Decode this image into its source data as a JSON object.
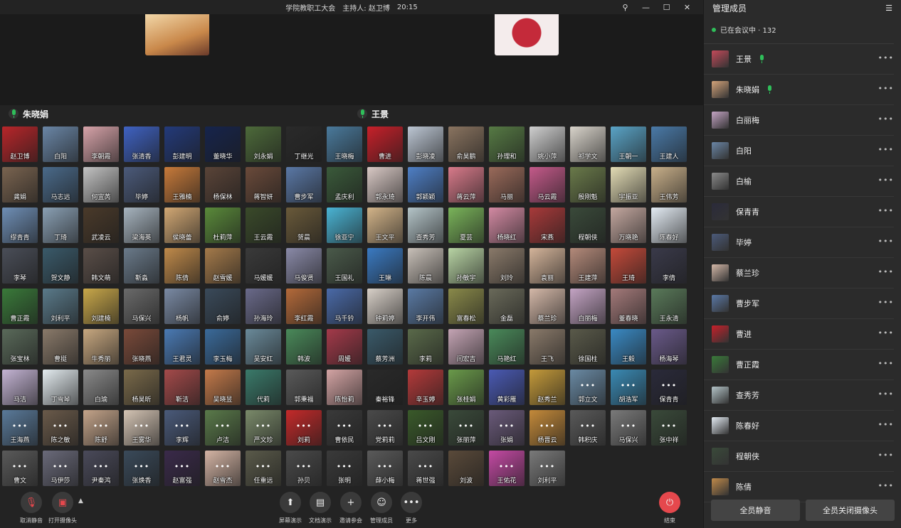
{
  "title": {
    "meeting": "学院教职工大会",
    "host": "主持人: 赵卫博",
    "time": "20:15"
  },
  "speakers": [
    {
      "name": "朱晓娟"
    },
    {
      "name": "王景"
    }
  ],
  "participants": [
    {
      "name": "赵卫博",
      "color": "#b8262a"
    },
    {
      "name": "白阳",
      "color": "#6a86a6"
    },
    {
      "name": "李朝霞",
      "color": "#d7a3a9"
    },
    {
      "name": "张清香",
      "color": "#3f62c2"
    },
    {
      "name": "彭建明",
      "color": "#233a7a"
    },
    {
      "name": "董晓华",
      "color": "#16244c"
    },
    {
      "name": "刘永娟",
      "color": "#4d6a3a"
    },
    {
      "name": "丁继光",
      "color": "#2a2a2a"
    },
    {
      "name": "王晓梅",
      "color": "#4a7a9c"
    },
    {
      "name": "曹进",
      "color": "#c7202a"
    },
    {
      "name": "彭晓凌",
      "color": "#bcc6d3"
    },
    {
      "name": "俞昊鹏",
      "color": "#8a7460"
    },
    {
      "name": "孙理和",
      "color": "#567a44"
    },
    {
      "name": "姚小萍",
      "color": "#cfcfcf"
    },
    {
      "name": "祁学文",
      "color": "#d9d4cb"
    },
    {
      "name": "王朝一",
      "color": "#5aa4c7"
    },
    {
      "name": "王建人",
      "color": "#4a7aa8"
    },
    {
      "name": "龚娟",
      "color": "#7a6450"
    },
    {
      "name": "马志远",
      "color": "#4a6a8a"
    },
    {
      "name": "何宜芮",
      "color": "#c3c3c3"
    },
    {
      "name": "毕婷",
      "color": "#4b5a7a"
    },
    {
      "name": "王雅楠",
      "color": "#c77a3a"
    },
    {
      "name": "杨保林",
      "color": "#5a4438"
    },
    {
      "name": "蒋智妍",
      "color": "#6a4a3a"
    },
    {
      "name": "曹步军",
      "color": "#5a78a6"
    },
    {
      "name": "孟庆利",
      "color": "#3a5a3a"
    },
    {
      "name": "郭永琦",
      "color": "#d9c9c5"
    },
    {
      "name": "郭颖颖",
      "color": "#4e7fc6"
    },
    {
      "name": "蒋云萍",
      "color": "#d87a8a"
    },
    {
      "name": "马丽",
      "color": "#9a6a5a"
    },
    {
      "name": "马云霞",
      "color": "#c45a8a"
    },
    {
      "name": "殷刚魁",
      "color": "#6a7a4a"
    },
    {
      "name": "宇振亚",
      "color": "#e3dcb5"
    },
    {
      "name": "王伟芳",
      "color": "#c9b08a"
    },
    {
      "name": "缪青青",
      "color": "#6f8fb6"
    },
    {
      "name": "丁琦",
      "color": "#8aa0b4"
    },
    {
      "name": "武凌云",
      "color": "#4a3a2a"
    },
    {
      "name": "梁海英",
      "color": "#a7b4bf"
    },
    {
      "name": "侯晓蕾",
      "color": "#d2a874"
    },
    {
      "name": "杜莉萍",
      "color": "#5a8a3a"
    },
    {
      "name": "王云霞",
      "color": "#3a4a2a"
    },
    {
      "name": "贺晨",
      "color": "#6a5a3a"
    },
    {
      "name": "徐亚宁",
      "color": "#4ab4d4"
    },
    {
      "name": "王文平",
      "color": "#d3b489"
    },
    {
      "name": "查秀芳",
      "color": "#b4c4c8"
    },
    {
      "name": "夏芸",
      "color": "#7ab45a"
    },
    {
      "name": "杨晓红",
      "color": "#d38aa3"
    },
    {
      "name": "宋燕",
      "color": "#a83a3a"
    },
    {
      "name": "程朝侠",
      "color": "#3a4a3a"
    },
    {
      "name": "万晓艳",
      "color": "#c4a8a0"
    },
    {
      "name": "陈春好",
      "color": "#e4ecf4"
    },
    {
      "name": "李琴",
      "color": "#4a4e58"
    },
    {
      "name": "贺文静",
      "color": "#3a5a6a"
    },
    {
      "name": "韩文萌",
      "color": "#5a4e48"
    },
    {
      "name": "靳淼",
      "color": "#6a7a8a"
    },
    {
      "name": "陈倩",
      "color": "#c08a4a"
    },
    {
      "name": "赵雪媛",
      "color": "#a47a4a"
    },
    {
      "name": "马媛媛",
      "color": "#3a3a3a"
    },
    {
      "name": "马俊贤",
      "color": "#8a8aa8"
    },
    {
      "name": "王国礼",
      "color": "#4a5a4a"
    },
    {
      "name": "王琳",
      "color": "#3a7ac2"
    },
    {
      "name": "陈晨",
      "color": "#c8c0b8"
    },
    {
      "name": "孙敏宇",
      "color": "#b8d4a4"
    },
    {
      "name": "刘玲",
      "color": "#8a7a6a"
    },
    {
      "name": "袁丽",
      "color": "#d4b49a"
    },
    {
      "name": "王建萍",
      "color": "#b48a7a"
    },
    {
      "name": "王琦",
      "color": "#c44a3a"
    },
    {
      "name": "李倩",
      "color": "#3a3a4a"
    },
    {
      "name": "曹正霞",
      "color": "#3a7a3a"
    },
    {
      "name": "刘利平",
      "color": "#5a7a8a"
    },
    {
      "name": "刘建楠",
      "color": "#c9a84a"
    },
    {
      "name": "马保兴",
      "color": "#6a6a6a"
    },
    {
      "name": "杨帆",
      "color": "#7a8aa4"
    },
    {
      "name": "俞婷",
      "color": "#3a4a5a"
    },
    {
      "name": "孙海玲",
      "color": "#6a6a8a"
    },
    {
      "name": "李红霞",
      "color": "#b46a3a"
    },
    {
      "name": "马千钤",
      "color": "#4a6aa8"
    },
    {
      "name": "钟莉婷",
      "color": "#d8d0c8"
    },
    {
      "name": "李开伟",
      "color": "#5a7aa4"
    },
    {
      "name": "富春松",
      "color": "#8a8a4a"
    },
    {
      "name": "金磊",
      "color": "#6a6a5a"
    },
    {
      "name": "蔡兰珍",
      "color": "#d4b8a8"
    },
    {
      "name": "白丽梅",
      "color": "#c4a4c4"
    },
    {
      "name": "董春晓",
      "color": "#a47a7a"
    },
    {
      "name": "王永清",
      "color": "#5a7a5a"
    },
    {
      "name": "张宝林",
      "color": "#5a6a5a"
    },
    {
      "name": "曹挺",
      "color": "#8a7a6a"
    },
    {
      "name": "牛秀丽",
      "color": "#c8a880"
    },
    {
      "name": "张晓燕",
      "color": "#7a4a3a"
    },
    {
      "name": "王君灵",
      "color": "#4a7ab4"
    },
    {
      "name": "李玉梅",
      "color": "#3a6a9a"
    },
    {
      "name": "吴安红",
      "color": "#6a8a9a"
    },
    {
      "name": "韩波",
      "color": "#4a8a5a"
    },
    {
      "name": "周媛",
      "color": "#a43a4a"
    },
    {
      "name": "蔡芳洲",
      "color": "#3a5a6a"
    },
    {
      "name": "李莉",
      "color": "#5a6a4a"
    },
    {
      "name": "闫宏吉",
      "color": "#c4a4b4"
    },
    {
      "name": "马艳红",
      "color": "#4a8a5a"
    },
    {
      "name": "王飞",
      "color": "#8a7a6a"
    },
    {
      "name": "徐国柱",
      "color": "#5a5a4a"
    },
    {
      "name": "王毅",
      "color": "#3a8ac4"
    },
    {
      "name": "杨海琴",
      "color": "#6a5a8a"
    },
    {
      "name": "马洁",
      "color": "#c4b4d4"
    },
    {
      "name": "丁雪琴",
      "color": "#e4ecf0"
    },
    {
      "name": "白瑜",
      "color": "#8a8a8a"
    },
    {
      "name": "杨昊昕",
      "color": "#7a6a4a"
    },
    {
      "name": "靳洁",
      "color": "#a44a4a"
    },
    {
      "name": "吴晓昱",
      "color": "#c47a4a"
    },
    {
      "name": "代莉",
      "color": "#3a7a6a"
    },
    {
      "name": "郭秉福",
      "color": "#5a5a5a"
    },
    {
      "name": "陈怡莉",
      "color": "#d4a4a4"
    },
    {
      "name": "秦裕锋",
      "color": "#2a2a2a"
    },
    {
      "name": "辛玉婷",
      "color": "#b43a3a"
    },
    {
      "name": "张桂娟",
      "color": "#6a9a4a"
    },
    {
      "name": "黄彩雁",
      "color": "#4a5ab4"
    },
    {
      "name": "赵秀兰",
      "color": "#c49a3a"
    },
    {
      "name": "郭立文",
      "color": "#6a8aa4"
    },
    {
      "name": "胡浩军",
      "color": "#3a8ab4"
    },
    {
      "name": "保青青",
      "color": "#2a2a3a"
    },
    {
      "name": "王海燕",
      "color": "#5a7a9a"
    },
    {
      "name": "陈之敏",
      "color": "#6a5a4a"
    },
    {
      "name": "陈舒",
      "color": "#c4a48a"
    },
    {
      "name": "王雾华",
      "color": "#d4c4b4"
    },
    {
      "name": "李辉",
      "color": "#4a5a7a"
    },
    {
      "name": "卢洁",
      "color": "#5a7a4a"
    },
    {
      "name": "严文珍",
      "color": "#7a8a6a"
    },
    {
      "name": "刘莉",
      "color": "#c42a2a"
    },
    {
      "name": "曹依民",
      "color": "#3a3a3a"
    },
    {
      "name": "党莉莉",
      "color": "#4a4a4a"
    },
    {
      "name": "吕文刚",
      "color": "#3a5a2a"
    },
    {
      "name": "张丽萍",
      "color": "#3a4a3a"
    },
    {
      "name": "张娟",
      "color": "#6a5a7a"
    },
    {
      "name": "杨晋云",
      "color": "#c48a3a"
    },
    {
      "name": "韩积庆",
      "color": "#5a5a5a"
    },
    {
      "name": "马保兴",
      "color": "#7a7a7a"
    },
    {
      "name": "张中祥",
      "color": "#3a4a3a"
    },
    {
      "name": "曹文",
      "color": "#5a5a5a"
    },
    {
      "name": "马伊莎",
      "color": "#6a6a7a"
    },
    {
      "name": "尹秦鸿",
      "color": "#4a4a5a"
    },
    {
      "name": "张焕香",
      "color": "#3a4a5a"
    },
    {
      "name": "赵富强",
      "color": "#3a2a4a"
    },
    {
      "name": "赵雪杰",
      "color": "#d4b4a4"
    },
    {
      "name": "任重远",
      "color": "#5a5a4a"
    },
    {
      "name": "孙贝",
      "color": "#4a4a4a"
    },
    {
      "name": "张明",
      "color": "#3a3a3a"
    },
    {
      "name": "薛小梅",
      "color": "#5a5a5a"
    },
    {
      "name": "蒋世强",
      "color": "#4a4a4a"
    },
    {
      "name": "刘波",
      "color": "#5a4a3a"
    },
    {
      "name": "王佑花",
      "color": "#c44aa4"
    },
    {
      "name": "刘利平",
      "color": "#7a7a7a"
    }
  ],
  "toolbar": {
    "mute": "取消静音",
    "camera": "打开摄像头",
    "share": "屏幕演示",
    "doc": "文档演示",
    "invite": "邀请参会",
    "manage": "管理成员",
    "more": "更多",
    "end": "结束"
  },
  "panel": {
    "title": "管理成员",
    "status": "已在会议中 · 132",
    "members": [
      {
        "name": "王景",
        "color": "#c44a5a",
        "speaking": true
      },
      {
        "name": "朱晓娟",
        "color": "#d4a47a",
        "speaking": true
      },
      {
        "name": "白丽梅",
        "color": "#c4a4c4",
        "speaking": false
      },
      {
        "name": "白阳",
        "color": "#6a86a6",
        "speaking": false
      },
      {
        "name": "白榆",
        "color": "#8a8a8a",
        "speaking": false
      },
      {
        "name": "保青青",
        "color": "#2a2a3a",
        "speaking": false
      },
      {
        "name": "毕婷",
        "color": "#4b5a7a",
        "speaking": false
      },
      {
        "name": "蔡兰珍",
        "color": "#d4b8a8",
        "speaking": false
      },
      {
        "name": "曹步军",
        "color": "#5a78a6",
        "speaking": false
      },
      {
        "name": "曹进",
        "color": "#c7202a",
        "speaking": false
      },
      {
        "name": "曹正霞",
        "color": "#3a7a3a",
        "speaking": false
      },
      {
        "name": "查秀芳",
        "color": "#b4c4c8",
        "speaking": false
      },
      {
        "name": "陈春好",
        "color": "#e4ecf4",
        "speaking": false
      },
      {
        "name": "程朝侠",
        "color": "#3a4a3a",
        "speaking": false
      },
      {
        "name": "陈倩",
        "color": "#c08a4a",
        "speaking": false
      }
    ],
    "mute_all": "全员静音",
    "camera_off_all": "全员关闭摄像头"
  }
}
